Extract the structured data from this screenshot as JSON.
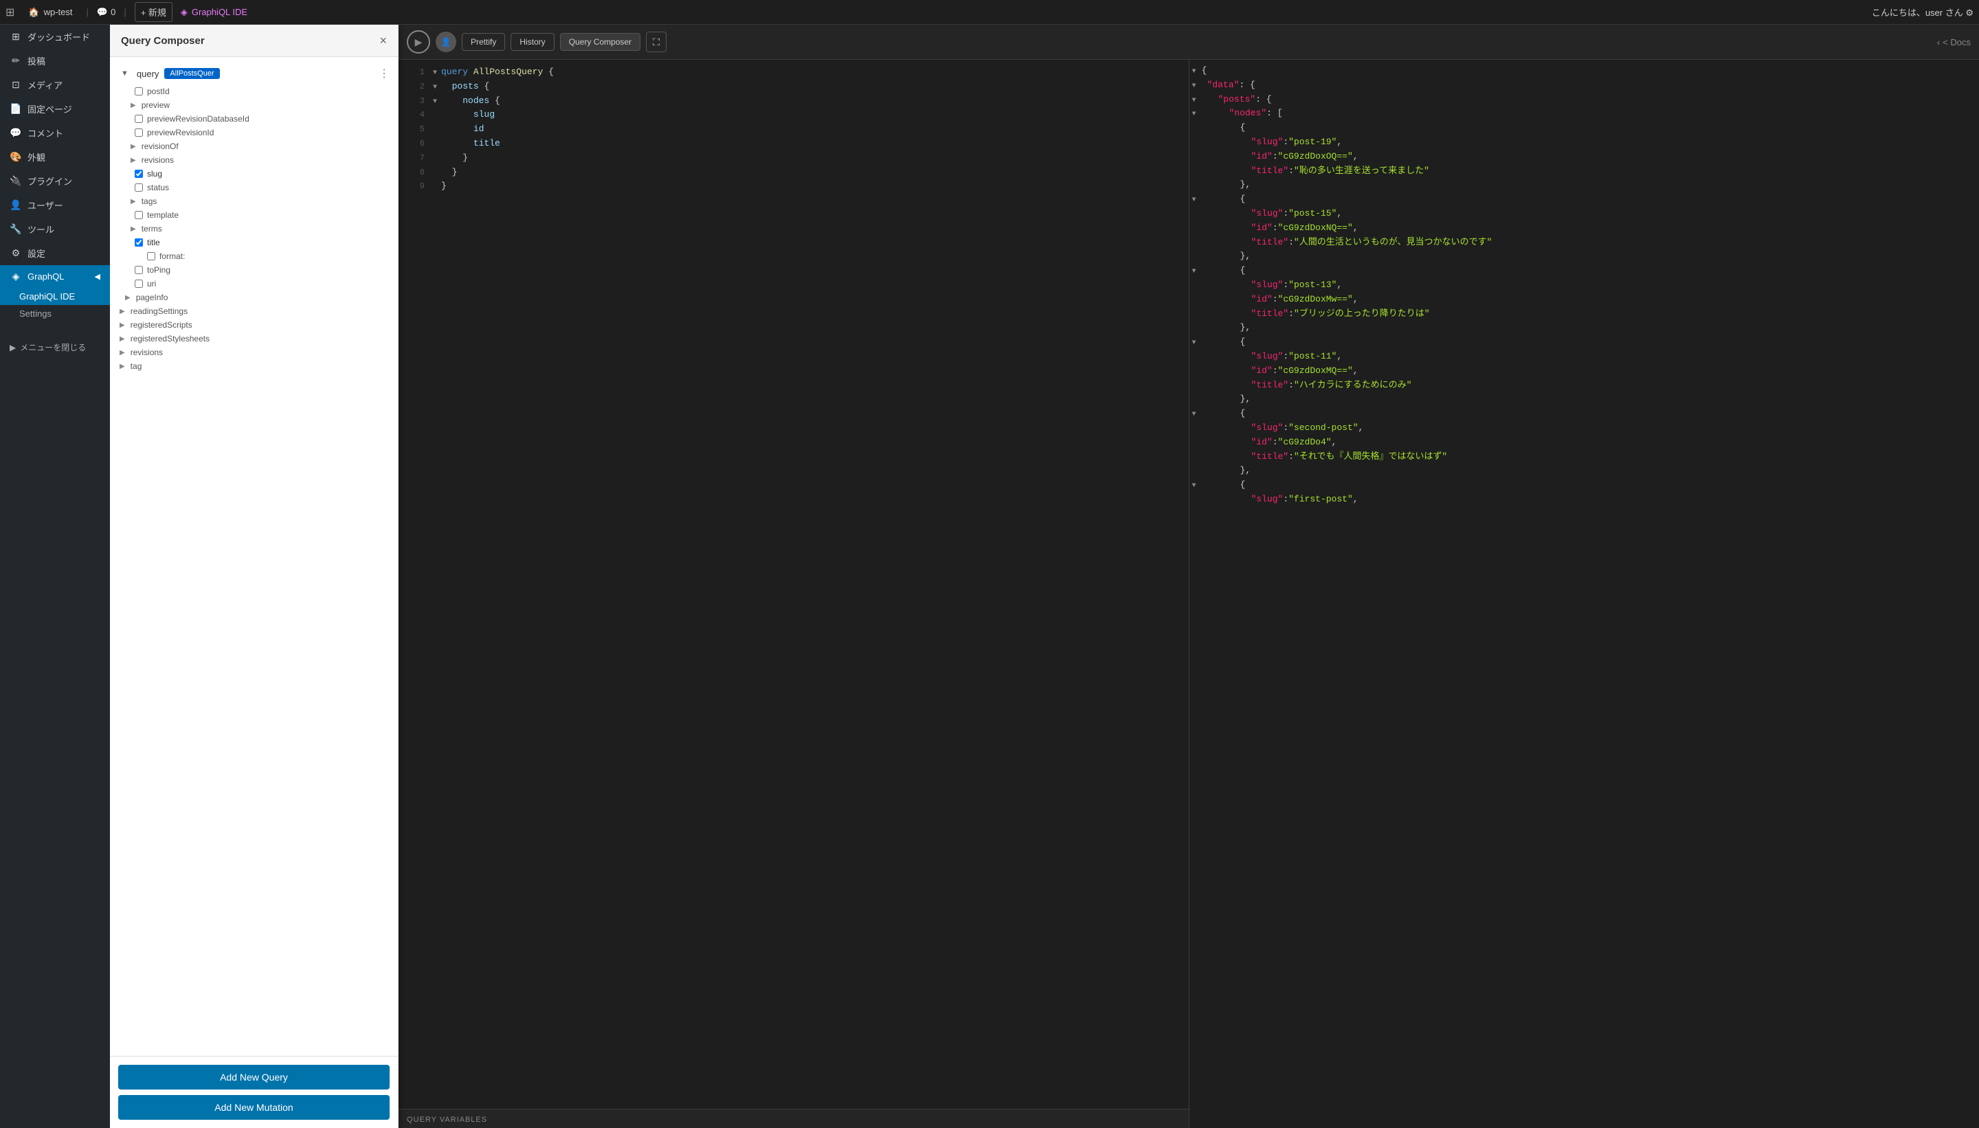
{
  "topbar": {
    "wp_icon": "⊞",
    "site_name": "wp-test",
    "comment_count": "0",
    "new_label": "+ 新規",
    "plugin_name": "GraphiQL IDE",
    "user_greeting": "こんにちは、user さん ⚙"
  },
  "sidebar": {
    "items": [
      {
        "id": "dashboard",
        "icon": "⊞",
        "label": "ダッシュボード"
      },
      {
        "id": "posts",
        "icon": "✏",
        "label": "投稿"
      },
      {
        "id": "media",
        "icon": "⊡",
        "label": "メディア"
      },
      {
        "id": "pages",
        "icon": "📄",
        "label": "固定ページ"
      },
      {
        "id": "comments",
        "icon": "💬",
        "label": "コメント"
      },
      {
        "id": "appearance",
        "icon": "🎨",
        "label": "外観"
      },
      {
        "id": "plugins",
        "icon": "🔌",
        "label": "プラグイン"
      },
      {
        "id": "users",
        "icon": "👤",
        "label": "ユーザー"
      },
      {
        "id": "tools",
        "icon": "🔧",
        "label": "ツール"
      },
      {
        "id": "settings",
        "icon": "⚙",
        "label": "設定"
      },
      {
        "id": "graphql",
        "icon": "◈",
        "label": "GraphQL",
        "active": true
      }
    ],
    "graphql_sub": [
      {
        "id": "ide",
        "label": "GraphiQL IDE",
        "active": true
      },
      {
        "id": "settings",
        "label": "Settings"
      }
    ],
    "collapse_label": "メニューを閉じる"
  },
  "query_composer": {
    "title": "Query Composer",
    "close_icon": "×",
    "query_label": "query",
    "query_badge": "AllPostsQuer",
    "more_icon": "⋮",
    "fields": [
      {
        "indent": 1,
        "type": "checkbox",
        "label": "postId",
        "checked": false
      },
      {
        "indent": 1,
        "type": "expand",
        "label": "preview",
        "checked": false
      },
      {
        "indent": 1,
        "type": "checkbox",
        "label": "previewRevisionDatabaseId",
        "checked": false
      },
      {
        "indent": 1,
        "type": "checkbox",
        "label": "previewRevisionId",
        "checked": false
      },
      {
        "indent": 1,
        "type": "expand",
        "label": "revisionOf",
        "checked": false
      },
      {
        "indent": 1,
        "type": "expand",
        "label": "revisions",
        "checked": false
      },
      {
        "indent": 1,
        "type": "checkbox",
        "label": "slug",
        "checked": true
      },
      {
        "indent": 1,
        "type": "checkbox",
        "label": "status",
        "checked": false
      },
      {
        "indent": 1,
        "type": "expand",
        "label": "tags",
        "checked": false
      },
      {
        "indent": 1,
        "type": "checkbox",
        "label": "template",
        "checked": false
      },
      {
        "indent": 1,
        "type": "expand",
        "label": "terms",
        "checked": false
      },
      {
        "indent": 1,
        "type": "checkbox",
        "label": "title",
        "checked": true
      },
      {
        "indent": 2,
        "type": "checkbox",
        "label": "format:",
        "checked": false
      },
      {
        "indent": 1,
        "type": "checkbox",
        "label": "toPing",
        "checked": false
      },
      {
        "indent": 1,
        "type": "checkbox",
        "label": "uri",
        "checked": false
      },
      {
        "indent": 0,
        "type": "expand",
        "label": "pageInfo",
        "checked": false
      },
      {
        "indent": 0,
        "type": "expand",
        "label": "readingSettings",
        "checked": false
      },
      {
        "indent": 0,
        "type": "expand",
        "label": "registeredScripts",
        "checked": false
      },
      {
        "indent": 0,
        "type": "expand",
        "label": "registeredStylesheets",
        "checked": false
      },
      {
        "indent": 0,
        "type": "expand",
        "label": "revisions",
        "checked": false
      },
      {
        "indent": 0,
        "type": "expand",
        "label": "tag",
        "checked": false
      }
    ],
    "add_query_label": "Add New Query",
    "add_mutation_label": "Add New Mutation"
  },
  "editor": {
    "lines": [
      {
        "num": 1,
        "fold": "▼",
        "content": "query AllPostsQuery {"
      },
      {
        "num": 2,
        "fold": "▼",
        "content": "  posts {"
      },
      {
        "num": 3,
        "fold": "▼",
        "content": "    nodes {"
      },
      {
        "num": 4,
        "fold": "",
        "content": "      slug"
      },
      {
        "num": 5,
        "fold": "",
        "content": "      id"
      },
      {
        "num": 6,
        "fold": "",
        "content": "      title"
      },
      {
        "num": 7,
        "fold": "",
        "content": "    }"
      },
      {
        "num": 8,
        "fold": "",
        "content": "  }"
      },
      {
        "num": 9,
        "fold": "",
        "content": "}"
      }
    ],
    "query_vars_label": "QUERY VARIABLES"
  },
  "toolbar": {
    "run_icon": "▶",
    "prettify_label": "Prettify",
    "history_label": "History",
    "query_composer_label": "Query Composer",
    "fullscreen_icon": "⛶",
    "docs_label": "< Docs"
  },
  "result": {
    "lines": [
      {
        "fold": "▼",
        "content": "{",
        "type": "paren"
      },
      {
        "fold": "▼",
        "indent": 2,
        "key": "\"data\"",
        "content": ": {",
        "type": "key-open"
      },
      {
        "fold": "▼",
        "indent": 4,
        "key": "\"posts\"",
        "content": ": {",
        "type": "key-open"
      },
      {
        "fold": "▼",
        "indent": 6,
        "key": "\"nodes\"",
        "content": ": [",
        "type": "key-open"
      },
      {
        "fold": "",
        "indent": 8,
        "content": "{",
        "type": "paren"
      },
      {
        "fold": "",
        "indent": 10,
        "key": "\"slug\"",
        "content": ": \"post-19\",",
        "type": "key-val"
      },
      {
        "fold": "",
        "indent": 10,
        "key": "\"id\"",
        "content": ": \"cG9zdDoxOQ==\",",
        "type": "key-val"
      },
      {
        "fold": "",
        "indent": 10,
        "key": "\"title\"",
        "content": ": \"恥の多い生涯を送って来ました\"",
        "type": "key-val"
      },
      {
        "fold": "",
        "indent": 8,
        "content": "},",
        "type": "paren"
      },
      {
        "fold": "▼",
        "indent": 8,
        "content": "{",
        "type": "paren"
      },
      {
        "fold": "",
        "indent": 10,
        "key": "\"slug\"",
        "content": ": \"post-15\",",
        "type": "key-val"
      },
      {
        "fold": "",
        "indent": 10,
        "key": "\"id\"",
        "content": ": \"cG9zdDoxNQ==\",",
        "type": "key-val"
      },
      {
        "fold": "",
        "indent": 10,
        "key": "\"title\"",
        "content": ": \"人間の生活というものが、見当つかないのです\"",
        "type": "key-val"
      },
      {
        "fold": "",
        "indent": 8,
        "content": "},",
        "type": "paren"
      },
      {
        "fold": "▼",
        "indent": 8,
        "content": "{",
        "type": "paren"
      },
      {
        "fold": "",
        "indent": 10,
        "key": "\"slug\"",
        "content": ": \"post-13\",",
        "type": "key-val"
      },
      {
        "fold": "",
        "indent": 10,
        "key": "\"id\"",
        "content": ": \"cG9zdDoxMw==\",",
        "type": "key-val"
      },
      {
        "fold": "",
        "indent": 10,
        "key": "\"title\"",
        "content": ": \"ブリッジの上ったり降りたりは\"",
        "type": "key-val"
      },
      {
        "fold": "",
        "indent": 8,
        "content": "},",
        "type": "paren"
      },
      {
        "fold": "▼",
        "indent": 8,
        "content": "{",
        "type": "paren"
      },
      {
        "fold": "",
        "indent": 10,
        "key": "\"slug\"",
        "content": ": \"post-11\",",
        "type": "key-val"
      },
      {
        "fold": "",
        "indent": 10,
        "key": "\"id\"",
        "content": ": \"cG9zdDoxMQ==\",",
        "type": "key-val"
      },
      {
        "fold": "",
        "indent": 10,
        "key": "\"title\"",
        "content": ": \"ハイカラにするためにのみ\"",
        "type": "key-val"
      },
      {
        "fold": "",
        "indent": 8,
        "content": "},",
        "type": "paren"
      },
      {
        "fold": "▼",
        "indent": 8,
        "content": "{",
        "type": "paren"
      },
      {
        "fold": "",
        "indent": 10,
        "key": "\"slug\"",
        "content": ": \"second-post\",",
        "type": "key-val"
      },
      {
        "fold": "",
        "indent": 10,
        "key": "\"id\"",
        "content": ": \"cG9zdDo4\",",
        "type": "key-val"
      },
      {
        "fold": "",
        "indent": 10,
        "key": "\"title\"",
        "content": ": \"それでも『人間失格』ではないはず\"",
        "type": "key-val"
      },
      {
        "fold": "",
        "indent": 8,
        "content": "},",
        "type": "paren"
      },
      {
        "fold": "▼",
        "indent": 8,
        "content": "{",
        "type": "paren"
      },
      {
        "fold": "",
        "indent": 10,
        "key": "\"slug\"",
        "content": ": \"first-post\",",
        "type": "key-val"
      }
    ]
  }
}
